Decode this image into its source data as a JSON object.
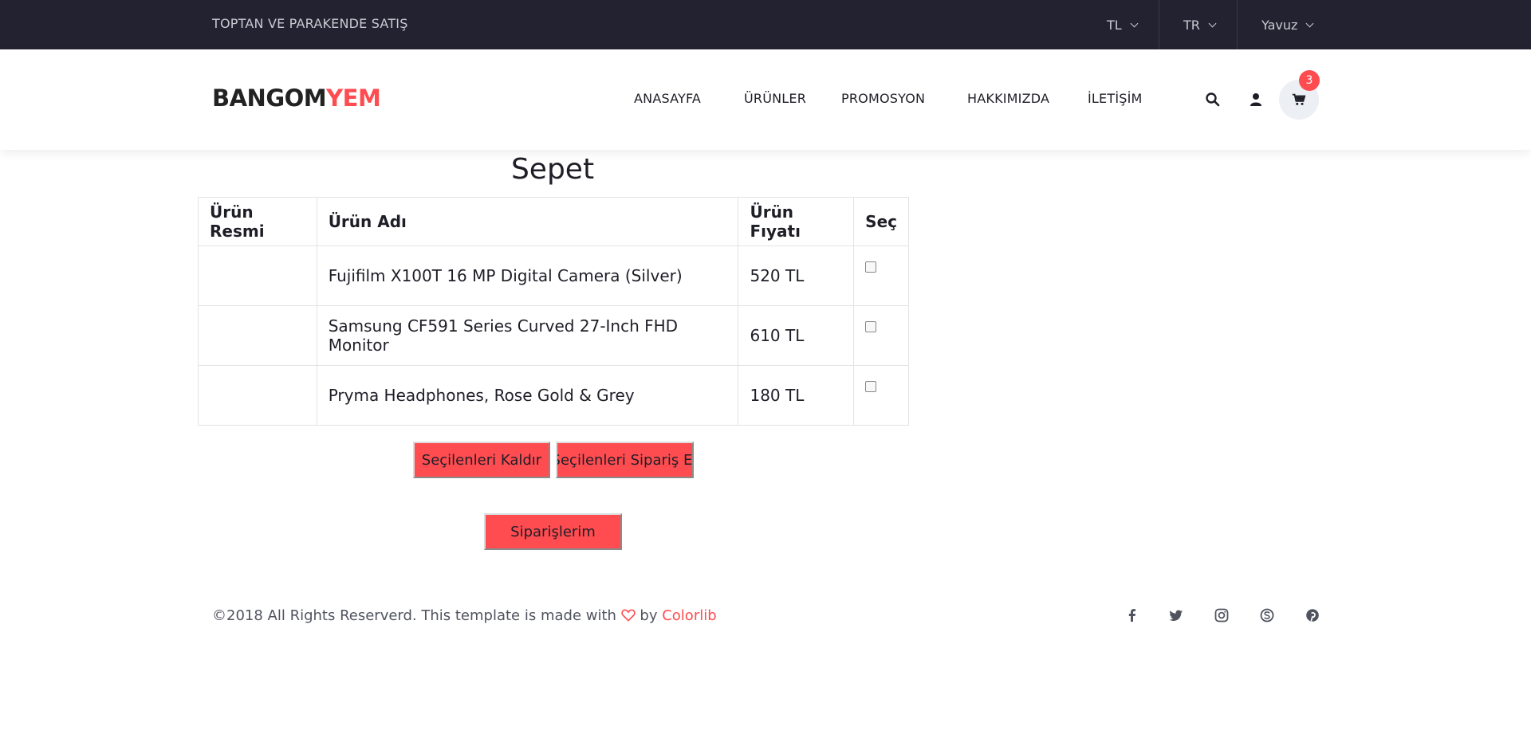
{
  "topbar": {
    "tagline": "TOPTAN VE PARAKENDE SATIŞ",
    "currency": "TL",
    "language": "TR",
    "user": "Yavuz"
  },
  "header": {
    "logo_part1": "BANGOM",
    "logo_part2": "YEM",
    "nav": [
      "ANASAYFA",
      "ÜRÜNLER",
      "PROMOSYON",
      "HAKKIMIZDA",
      "İLETİŞİM"
    ],
    "cart_count": "3"
  },
  "main": {
    "title": "Sepet",
    "columns": [
      "Ürün Resmi",
      "Ürün Adı",
      "Ürün Fıyatı",
      "Seç"
    ],
    "rows": [
      {
        "image": "",
        "name": "Fujifilm X100T 16 MP Digital Camera (Silver)",
        "price": "520 TL"
      },
      {
        "image": "",
        "name": "Samsung CF591 Series Curved 27-Inch FHD Monitor",
        "price": "610 TL"
      },
      {
        "image": "",
        "name": "Pryma Headphones, Rose Gold & Grey",
        "price": "180 TL"
      }
    ],
    "remove_label": "Seçilenleri Kaldır",
    "order_label": "Seçilenleri Sipariş Et",
    "my_orders_label": "Siparişlerim"
  },
  "footer": {
    "text_before": "©2018 All Rights Reserverd. This template is made with",
    "text_by": "by",
    "brand": "Colorlib",
    "social": [
      "facebook-icon",
      "twitter-icon",
      "instagram-icon",
      "skype-icon",
      "pinterest-icon"
    ]
  },
  "colors": {
    "accent": "#fe4c50",
    "topbar": "#232230",
    "text": "#1e1e27"
  }
}
